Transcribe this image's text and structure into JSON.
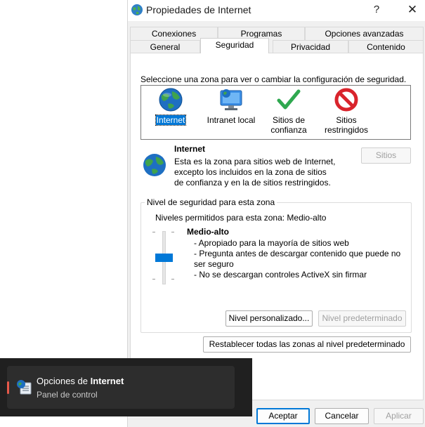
{
  "window": {
    "title": "Propiedades de Internet",
    "help_glyph": "?",
    "close_glyph": "✕"
  },
  "tabs": {
    "row1": [
      "Conexiones",
      "Programas",
      "Opciones avanzadas"
    ],
    "row2": [
      "General",
      "Seguridad",
      "Privacidad",
      "Contenido"
    ],
    "active": "Seguridad"
  },
  "security": {
    "prompt": "Seleccione una zona para ver o cambiar la configuración de seguridad.",
    "zones": [
      {
        "label": "Internet",
        "icon": "globe-icon",
        "selected": true
      },
      {
        "label": "Intranet local",
        "icon": "monitor-globe-icon",
        "selected": false
      },
      {
        "label": "Sitios de confianza",
        "icon": "green-check-icon",
        "selected": false
      },
      {
        "label": "Sitios restringidos",
        "icon": "no-entry-icon",
        "selected": false
      }
    ],
    "zone_name": "Internet",
    "zone_description": "Esta es la zona para sitios web de Internet, excepto los incluidos en la zona de sitios de confianza y en la de sitios restringidos.",
    "sites_button": "Sitios",
    "group_title": "Nivel de seguridad para esta zona",
    "allowed_levels": "Niveles permitidos para esta zona: Medio-alto",
    "level_name": "Medio-alto",
    "level_bullets": [
      "- Apropiado para la mayoría de sitios web",
      "- Pregunta antes de descargar contenido que puede no ser seguro",
      "- No se descargan controles ActiveX sin firmar"
    ],
    "custom_level_button": "Nivel personalizado...",
    "default_level_button": "Nivel predeterminado",
    "reset_all_button": "Restablecer todas las zonas al nivel predeterminado"
  },
  "footer": {
    "ok": "Aceptar",
    "cancel": "Cancelar",
    "apply": "Aplicar"
  },
  "popup": {
    "title_prefix": "Opciones de ",
    "title_bold": "Internet",
    "subtitle": "Panel de control"
  },
  "colors": {
    "accent": "#0078d7",
    "popup_bg": "#202020",
    "popup_card": "#2d2d2d"
  }
}
